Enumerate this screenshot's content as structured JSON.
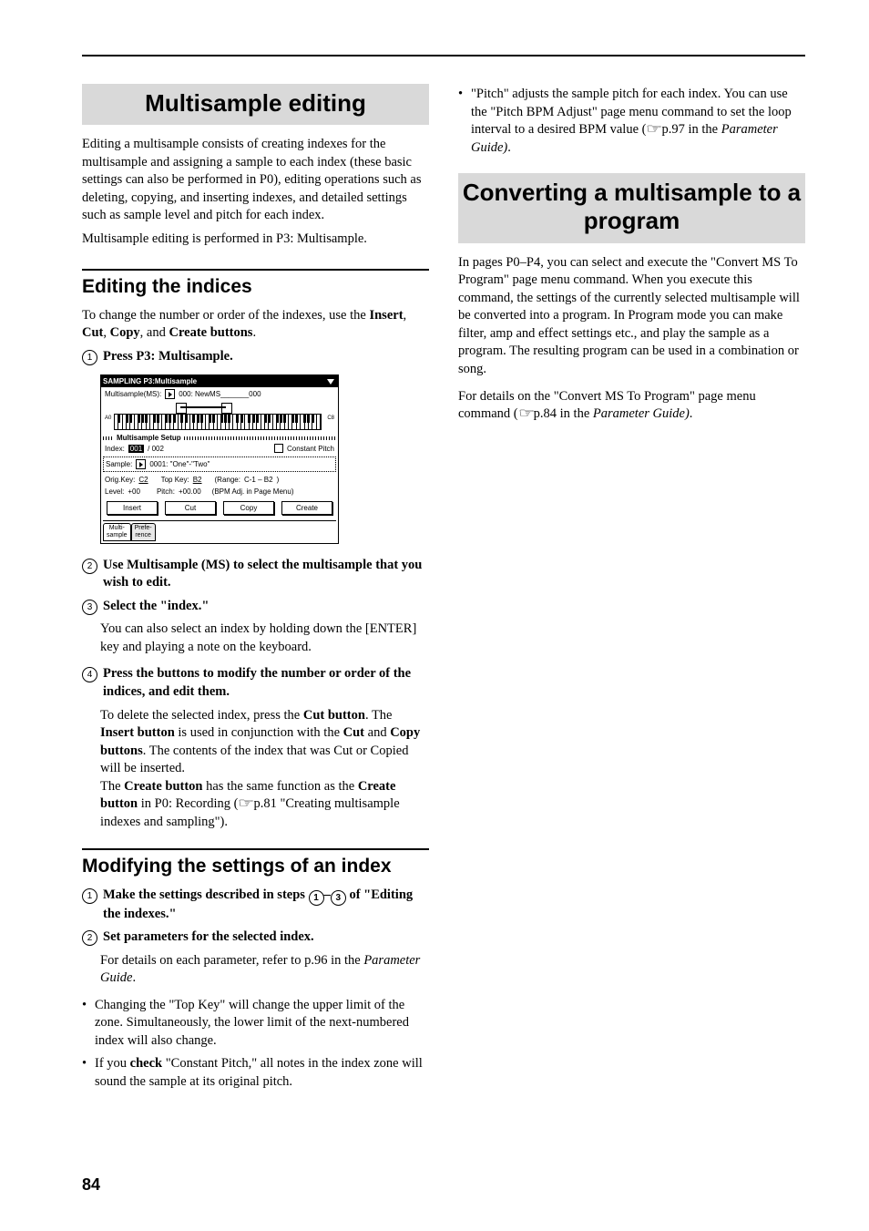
{
  "page_number": "84",
  "left": {
    "banner1": "Multisample editing",
    "intro1": "Editing a multisample consists of creating indexes for the multisample and assigning a sample to each index (these basic settings can also be performed in P0), editing operations such as deleting, copying, and inserting indexes, and detailed settings such as sample level and pitch for each index.",
    "intro2": "Multisample editing is performed in P3: Multisample.",
    "h2a": "Editing the indices",
    "p_a1_pre": "To change the number or order of the indexes, use the ",
    "p_a1_b1": "Insert",
    "p_a1_m1": ", ",
    "p_a1_b2": "Cut",
    "p_a1_m2": ", ",
    "p_a1_b3": "Copy",
    "p_a1_m3": ", and ",
    "p_a1_b4": "Create buttons",
    "p_a1_end": ".",
    "steps_a": {
      "s1": {
        "n": "1",
        "text": "Press P3: Multisample."
      },
      "s2": {
        "n": "2",
        "text": "Use Multisample (MS) to select the multisample that you wish to edit."
      },
      "s3": {
        "n": "3",
        "text": "Select the \"index.\""
      },
      "s3_body": "You can also select an index by holding down the [ENTER] key and playing a note on the keyboard.",
      "s4": {
        "n": "4",
        "text": "Press the buttons to modify the number or order of the indices, and edit them."
      },
      "s4_body_1a": "To delete the selected index, press the ",
      "s4_body_1b": "Cut button",
      "s4_body_1c": ". The ",
      "s4_body_1d": "Insert button",
      "s4_body_1e": " is used in conjunction with the ",
      "s4_body_1f": "Cut",
      "s4_body_1g": " and ",
      "s4_body_1h": "Copy buttons",
      "s4_body_1i": ". The contents of the index that was Cut or Copied will be inserted.",
      "s4_body_2a": "The ",
      "s4_body_2b": "Create button",
      "s4_body_2c": " has the same function as the ",
      "s4_body_2d": "Create button",
      "s4_body_2e": " in P0: Recording (",
      "s4_body_2f": "p.81 \"Creating multisample indexes and sampling\").",
      "pref_glyph": "☞"
    },
    "h2b": "Modifying the settings of an index",
    "steps_b": {
      "s1": {
        "n": "1",
        "pre": "Make the settings described in steps ",
        "mid": "–",
        "post": " of \"Editing the indexes.\"",
        "r1": "1",
        "r3": "3"
      },
      "s2": {
        "n": "2",
        "text": "Set parameters for the selected index."
      },
      "s2_body_a": "For details on each parameter, refer to p.96 in the ",
      "s2_body_b": "Parameter Guide",
      "s2_body_c": "."
    },
    "bullets": {
      "b1": "Changing the \"Top Key\" will change the upper limit of the zone. Simultaneously, the lower limit of the next-numbered index will also change.",
      "b2_a": "If you ",
      "b2_b": "check",
      "b2_c": " \"Constant Pitch,\" all notes in the index zone will sound the sample at its original pitch."
    },
    "screenshot": {
      "title": "SAMPLING P3:Multisample",
      "ms_label": "Multisample(MS):",
      "ms_value": "000: NewMS_______000",
      "kbd_left": "A0",
      "kbd_right": "C8",
      "section": "Multisample Setup",
      "index_label": "Index:",
      "index_val": "001",
      "index_total": "/ 002",
      "const_pitch": "Constant Pitch",
      "sample_label": "Sample:",
      "sample_value": "0001: \"One\"-\"Two\"",
      "origkey_label": "Orig.Key:",
      "origkey_val": "C2",
      "topkey_label": "Top Key:",
      "topkey_val": "B2",
      "range_label": "(Range:",
      "range_val": "C-1  –  B2",
      "range_end": ")",
      "level_label": "Level:",
      "level_val": "+00",
      "pitch_label": "Pitch:",
      "pitch_val": "+00.00",
      "bpm_note": "(BPM Adj. in Page Menu)",
      "btn_insert": "Insert",
      "btn_cut": "Cut",
      "btn_copy": "Copy",
      "btn_create": "Create",
      "tab1a": "Multi-",
      "tab1b": "sample",
      "tab2a": "Prefe-",
      "tab2b": "rence"
    }
  },
  "right": {
    "bullet_pitch_a": "\"Pitch\" adjusts the sample pitch for each index. You can use the \"Pitch BPM Adjust\" page menu command to set the loop interval to a desired BPM value (",
    "bullet_pitch_b": "p.97 in the ",
    "bullet_pitch_c": "Parameter Guide)",
    "bullet_pitch_d": ".",
    "pref_glyph": "☞",
    "banner2": "Converting a multisample to a program",
    "p1": "In pages P0–P4, you can select and execute the \"Convert MS To Program\" page menu command. When you execute this command, the settings of the currently selected multisample will be converted into a program. In Program mode you can make filter, amp and effect settings etc., and play the sample as a program. The resulting program can be used in a combination or song.",
    "p2_a": "For details on the \"Convert MS To Program\" page menu command (",
    "p2_b": "p.84 in the ",
    "p2_c": "Parameter Guide)",
    "p2_d": "."
  }
}
